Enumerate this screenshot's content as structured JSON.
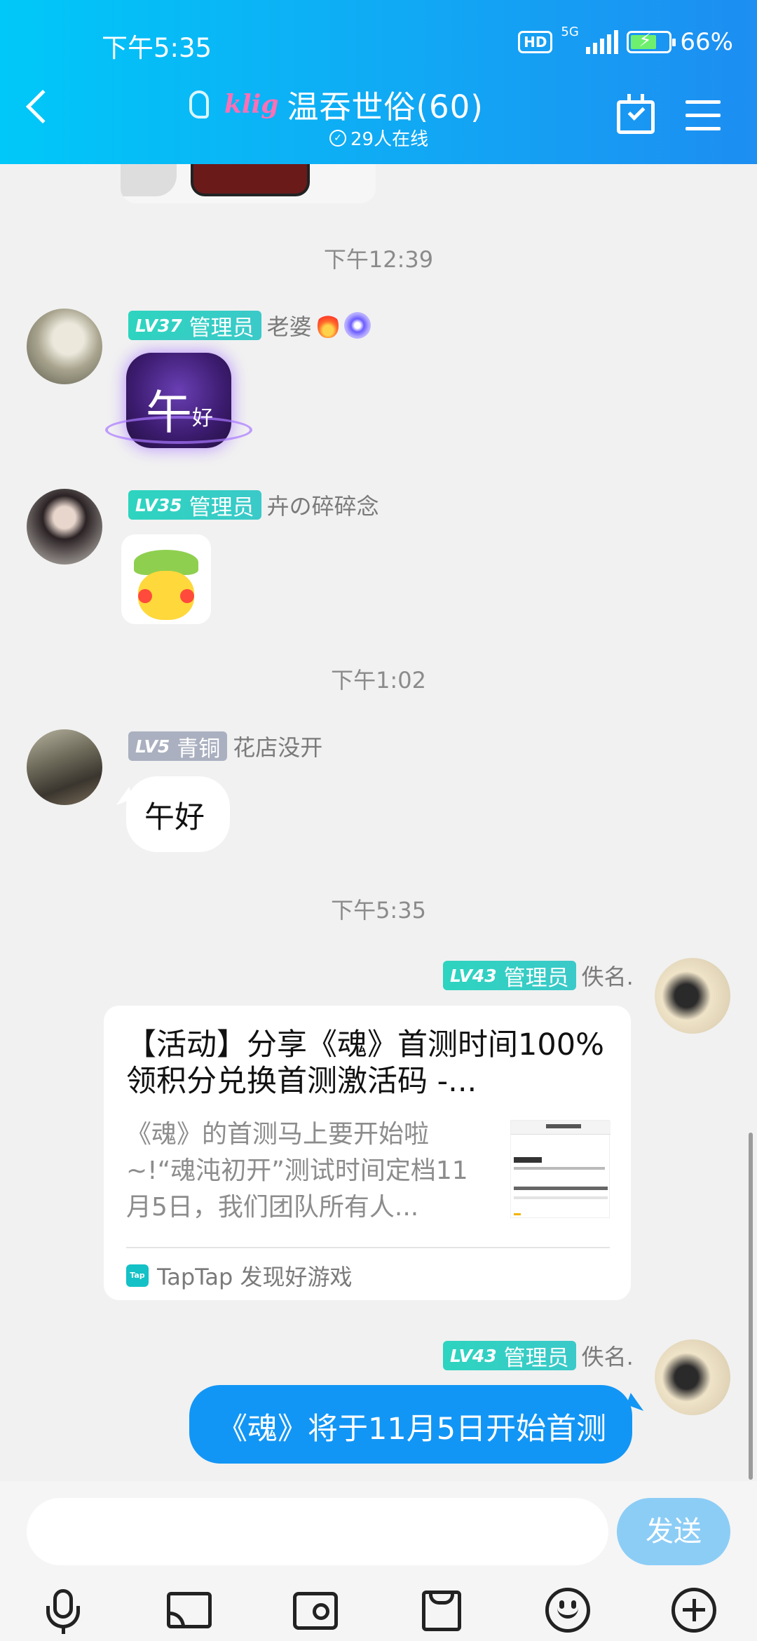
{
  "status_bar": {
    "time": "下午5:35",
    "hd": "HD",
    "network": "5G",
    "battery": "66%"
  },
  "header": {
    "brand": "klig",
    "title": "温吞世俗(60)",
    "online_count": "29人在线"
  },
  "messages": [
    {
      "type": "timestamp",
      "text": "下午12:39"
    },
    {
      "type": "sticker",
      "sender": "老婆",
      "level": "LV37",
      "role": "管理员",
      "sticker_text_1": "午",
      "sticker_text_2": "好"
    },
    {
      "type": "sticker",
      "sender": "卉の碎碎念",
      "level": "LV35",
      "role": "管理员"
    },
    {
      "type": "timestamp",
      "text": "下午1:02"
    },
    {
      "type": "text",
      "sender": "花店没开",
      "level": "LV5",
      "role": "青铜",
      "text": "午好"
    },
    {
      "type": "timestamp",
      "text": "下午5:35"
    },
    {
      "type": "card",
      "sender": "佚名.",
      "level": "LV43",
      "role": "管理员",
      "title": "【活动】分享《魂》首测时间100%领积分兑换首测激活码 -...",
      "description": "《魂》的首测马上要开始啦~!“魂沌初开”测试时间定档11月5日，我们团队所有人...",
      "source_icon": "Tap",
      "source": "TapTap 发现好游戏"
    },
    {
      "type": "text",
      "sender": "佚名.",
      "level": "LV43",
      "role": "管理员",
      "text": "《魂》将于11月5日开始首测"
    }
  ],
  "input": {
    "placeholder": "",
    "send_label": "发送"
  },
  "colors": {
    "header_start": "#00c8f8",
    "header_end": "#1d8ef2",
    "self_bubble": "#1296f5",
    "admin_badge": "#2dd4bf",
    "bronze_badge": "#aab0bf",
    "send_button": "#8ccdf6"
  }
}
